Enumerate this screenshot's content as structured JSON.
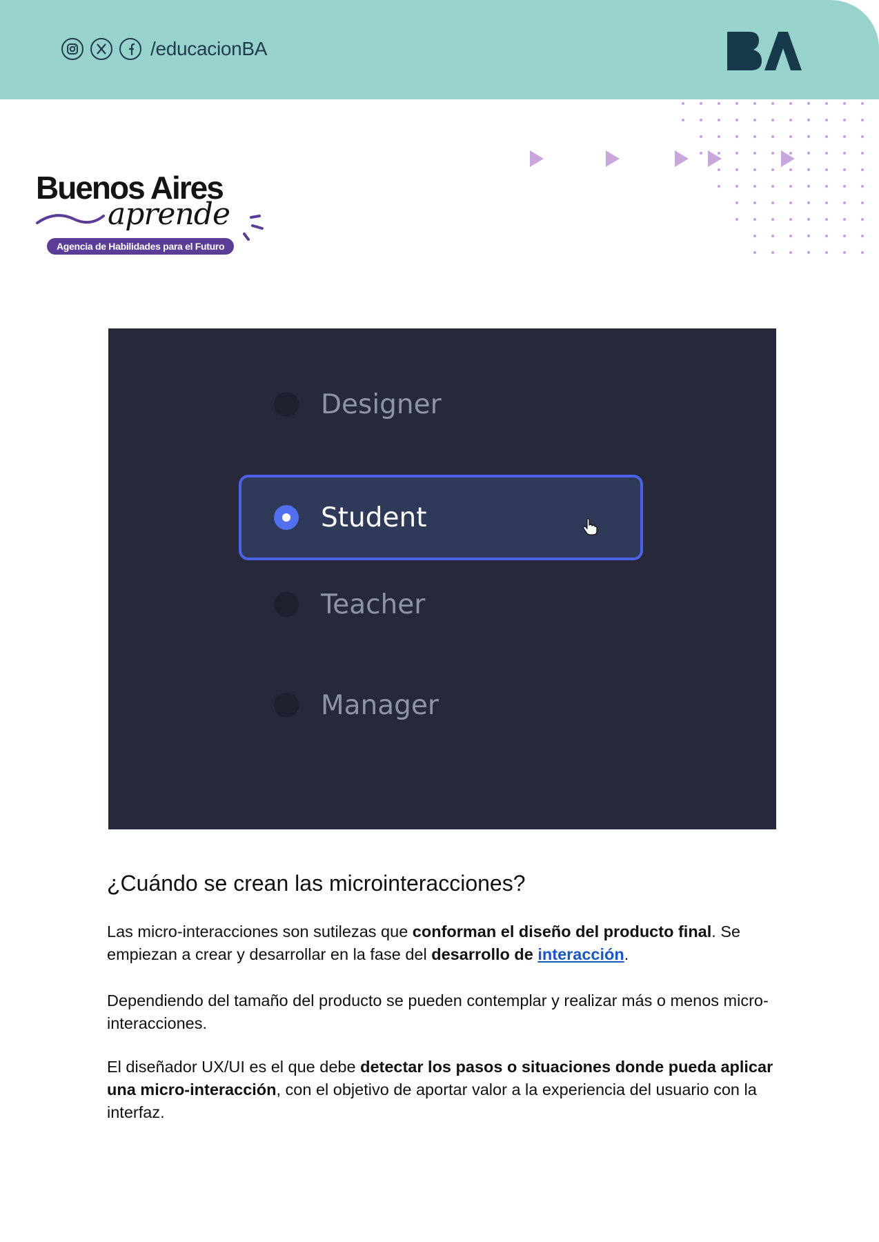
{
  "header": {
    "social_icons": [
      "instagram-icon",
      "x-icon",
      "facebook-icon"
    ],
    "handle": "/educacionBA",
    "logo_text": "BA",
    "bg_color": "#97d3cc"
  },
  "brand": {
    "title": "Buenos Aires",
    "script": "aprende",
    "tagline": "Agencia de Habilidades para el Futuro",
    "accent_color": "#5b3d98"
  },
  "screenshot": {
    "options": [
      {
        "label": "Designer",
        "selected": false
      },
      {
        "label": "Student",
        "selected": true
      },
      {
        "label": "Teacher",
        "selected": false
      },
      {
        "label": "Manager",
        "selected": false
      }
    ],
    "bg_color": "#27293a",
    "accent_color": "#4a63e8"
  },
  "article": {
    "heading": "¿Cuándo se crean las microinteracciones?",
    "p1": {
      "a": "Las micro-interacciones son sutilezas que ",
      "b": "conforman el diseño del producto final",
      "c": ". Se empiezan a crear y desarrollar en la fase del ",
      "d": "desarrollo de ",
      "link": "interacción",
      "e": "."
    },
    "p2": "Dependiendo del tamaño del producto se pueden contemplar y realizar más o menos micro-interacciones.",
    "p3": {
      "a": "El diseñador UX/UI es el que debe ",
      "b": "detectar los pasos o situaciones donde pueda aplicar una micro-interacción",
      "c": ", con el objetivo de aportar valor a la experiencia del usuario con la interfaz."
    },
    "link_color": "#1a56c8"
  }
}
